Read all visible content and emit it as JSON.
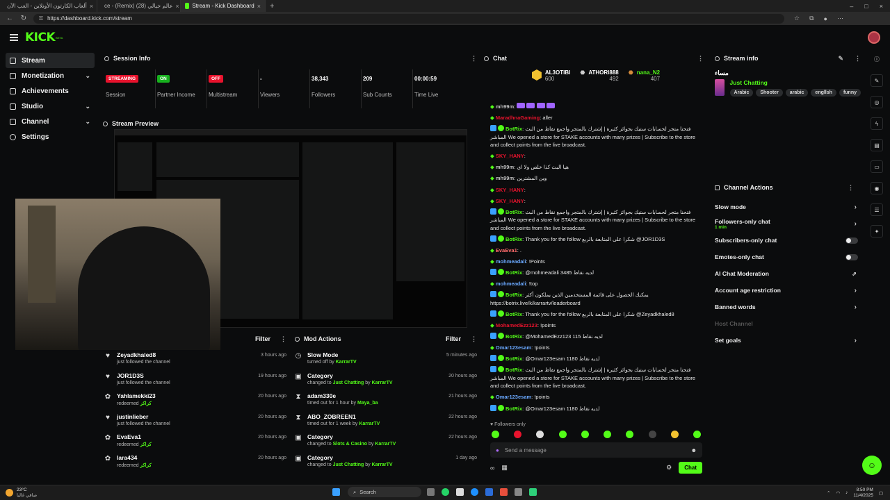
{
  "browser": {
    "tabs": [
      {
        "title": "ألعاب الكارتون الأونلاين - العب الآن",
        "active": false
      },
      {
        "title": "ce - (Remix) عالم خيالي (28)",
        "active": false
      },
      {
        "title": "Stream - Kick Dashboard",
        "active": true
      }
    ],
    "url": "https://dashboard.kick.com/stream"
  },
  "app": {
    "logo": "KICK",
    "logo_sup": "BETA"
  },
  "nav": {
    "items": [
      {
        "label": "Stream",
        "active": true,
        "chevron": false
      },
      {
        "label": "Monetization",
        "active": false,
        "chevron": true
      },
      {
        "label": "Achievements",
        "active": false,
        "chevron": false
      },
      {
        "label": "Studio",
        "active": false,
        "chevron": true
      },
      {
        "label": "Channel",
        "active": false,
        "chevron": true
      },
      {
        "label": "Settings",
        "active": false,
        "chevron": false
      }
    ]
  },
  "session": {
    "title": "Session Info",
    "stats": [
      {
        "value": "STREAMING",
        "label": "Session",
        "badge": "#e8132d"
      },
      {
        "value": "ON",
        "label": "Partner Income",
        "badge": "#18b21f"
      },
      {
        "value": "OFF",
        "label": "Multistream",
        "badge": "#e8132d"
      },
      {
        "value": "-",
        "label": "Viewers"
      },
      {
        "value": "38,343",
        "label": "Followers"
      },
      {
        "value": "209",
        "label": "Sub Counts"
      },
      {
        "value": "00:00:59",
        "label": "Time Live"
      }
    ]
  },
  "preview": {
    "title": "Stream Preview"
  },
  "activity": {
    "filter_label": "Filter",
    "rows": [
      {
        "name": "Zeyadkhaled8",
        "sub": "just followed the channel",
        "time": "3 hours ago",
        "icon": "♥"
      },
      {
        "name": "JOR1D3S",
        "sub": "just followed the channel",
        "time": "19 hours ago",
        "icon": "♥"
      },
      {
        "name": "Yahlamekki23",
        "sub": "redeemed",
        "reward": "كراكر",
        "time": "20 hours ago",
        "icon": "✿"
      },
      {
        "name": "justinlieber",
        "sub": "just followed the channel",
        "time": "20 hours ago",
        "icon": "♥"
      },
      {
        "name": "EvaEva1",
        "sub": "redeemed",
        "reward": "كراكر",
        "time": "20 hours ago",
        "icon": "✿"
      },
      {
        "name": "lara434",
        "sub": "redeemed",
        "reward": "كراكر",
        "time": "20 hours ago",
        "icon": "✿"
      }
    ]
  },
  "mod": {
    "title": "Mod Actions",
    "filter_label": "Filter",
    "rows": [
      {
        "name": "Slow Mode",
        "sub": "turned off by",
        "who": "KarrarTV",
        "time": "5 minutes ago",
        "icon": "◷"
      },
      {
        "name": "Category",
        "sub": "changed to",
        "target": "Just Chatting",
        "who": "KarrarTV",
        "time": "20 hours ago",
        "icon": "▣"
      },
      {
        "name": "adam330e",
        "sub": "timed out for 1 hour by",
        "who": "Maya_ba",
        "time": "21 hours ago",
        "icon": "⧗"
      },
      {
        "name": "ABO_ZOBREEN1",
        "sub": "timed out for 1 week by",
        "who": "KarrarTV",
        "time": "22 hours ago",
        "icon": "⧗"
      },
      {
        "name": "Category",
        "sub": "changed to",
        "target": "Slots & Casino",
        "who": "KarrarTV",
        "time": "22 hours ago",
        "icon": "▣"
      },
      {
        "name": "Category",
        "sub": "changed to",
        "target": "Just Chatting",
        "who": "KarrarTV",
        "time": "1 day ago",
        "icon": "▣"
      }
    ]
  },
  "chat": {
    "title": "Chat",
    "pinned": [
      {
        "name": "AL3OTIBI",
        "points": "600"
      },
      {
        "name": "ATHORI888",
        "points": "492"
      },
      {
        "name": "nana_N2",
        "points": "407"
      }
    ],
    "messages": [
      {
        "user": "mh99m",
        "color": "#c0c0c0",
        "text": "",
        "emotes": 4
      },
      {
        "user": "MaradhnaGaming",
        "color": "#e8132d",
        "text": "aller"
      },
      {
        "user": "BotRix",
        "color": "#53fc18",
        "text": "فتحنا متجر لحسابات ستيك بجوائز كثيرة | إشترك بالمتجر واجمع نقاط من البث المباشر We opened a store for STAKE accounts with many prizes | Subscribe to the store and collect points from the live broadcast."
      },
      {
        "user": "SKY_HANY",
        "color": "#e8132d",
        "text": ""
      },
      {
        "user": "mh99m",
        "color": "#c0c0c0",
        "text": "هيا البث كذا خلص ولا اي"
      },
      {
        "user": "mh99m",
        "color": "#c0c0c0",
        "text": "وين المشترين"
      },
      {
        "user": "SKY_HANY",
        "color": "#e8132d",
        "text": ""
      },
      {
        "user": "SKY_HANY",
        "color": "#e8132d",
        "text": ""
      },
      {
        "user": "BotRix",
        "color": "#53fc18",
        "text": "فتحنا متجر لحسابات ستيك بجوائز كثيرة | إشترك بالمتجر واجمع نقاط من البث المباشر We opened a store for STAKE accounts with many prizes | Subscribe to the store and collect points from the live broadcast."
      },
      {
        "user": "BotRix",
        "color": "#53fc18",
        "text": "Thank you for the follow شكرا على المتابعة بالربع @JOR1D3S"
      },
      {
        "user": "EvaEva1",
        "color": "#ff6b6b",
        "text": "."
      },
      {
        "user": "mohmeadali",
        "color": "#6aa8ff",
        "text": "!Points"
      },
      {
        "user": "BotRix",
        "color": "#53fc18",
        "text": "@mohmeadali 3485 لديه نقاط"
      },
      {
        "user": "mohmeadali",
        "color": "#6aa8ff",
        "text": "!top"
      },
      {
        "user": "BotRix",
        "color": "#53fc18",
        "text": "يمكنك الحصول على قائمة المستخدمين الذين يملكون أكثر https://botrix.live/k/karrartv/leaderboard"
      },
      {
        "user": "BotRix",
        "color": "#53fc18",
        "text": "Thank you for the follow شكرا على المتابعة بالربع @Zeyadkhaled8"
      },
      {
        "user": "MohamedEzz123",
        "color": "#e8132d",
        "text": "!points"
      },
      {
        "user": "BotRix",
        "color": "#53fc18",
        "text": "@MohamedEzz123 115 لديه نقاط"
      },
      {
        "user": "Omar123esam",
        "color": "#6aa8ff",
        "text": "!points"
      },
      {
        "user": "BotRix",
        "color": "#53fc18",
        "text": "@Omar123esam 1180 لديه نقاط"
      },
      {
        "user": "BotRix",
        "color": "#53fc18",
        "text": "فتحنا متجر لحسابات ستيك بجوائز كثيرة | إشترك بالمتجر واجمع نقاط من البث المباشر We opened a store for STAKE accounts with many prizes | Subscribe to the store and collect points from the live broadcast."
      },
      {
        "user": "Omar123esam",
        "color": "#6aa8ff",
        "text": "!points"
      },
      {
        "user": "BotRix",
        "color": "#53fc18",
        "text": "@Omar123esam 1180 لديه نقاط"
      }
    ],
    "followers_only": "Followers only",
    "input_placeholder": "Send a message",
    "send_label": "Chat"
  },
  "streaminfo": {
    "title": "Stream info",
    "stream_title": "مساء",
    "category": "Just Chatting",
    "tags": [
      "Arabic",
      "Shooter",
      "arabic",
      "engllsh",
      "funny"
    ]
  },
  "actions": {
    "title": "Channel Actions",
    "items": [
      {
        "label": "Slow mode",
        "kind": "arrow"
      },
      {
        "label": "Followers-only chat",
        "sub": "1 min",
        "kind": "arrow"
      },
      {
        "label": "Subscribers-only chat",
        "kind": "toggle"
      },
      {
        "label": "Emotes-only chat",
        "kind": "toggle"
      },
      {
        "label": "AI Chat Moderation",
        "kind": "link"
      },
      {
        "label": "Account age restriction",
        "kind": "arrow"
      },
      {
        "label": "Banned words",
        "kind": "arrow"
      },
      {
        "label": "Host Channel",
        "kind": "disabled"
      },
      {
        "label": "Set goals",
        "kind": "arrow"
      }
    ]
  },
  "taskbar": {
    "weather_temp": "23°C",
    "weather_desc": "صافي غالبا",
    "search": "Search",
    "time": "8:50 PM",
    "date": "11/4/2025"
  }
}
